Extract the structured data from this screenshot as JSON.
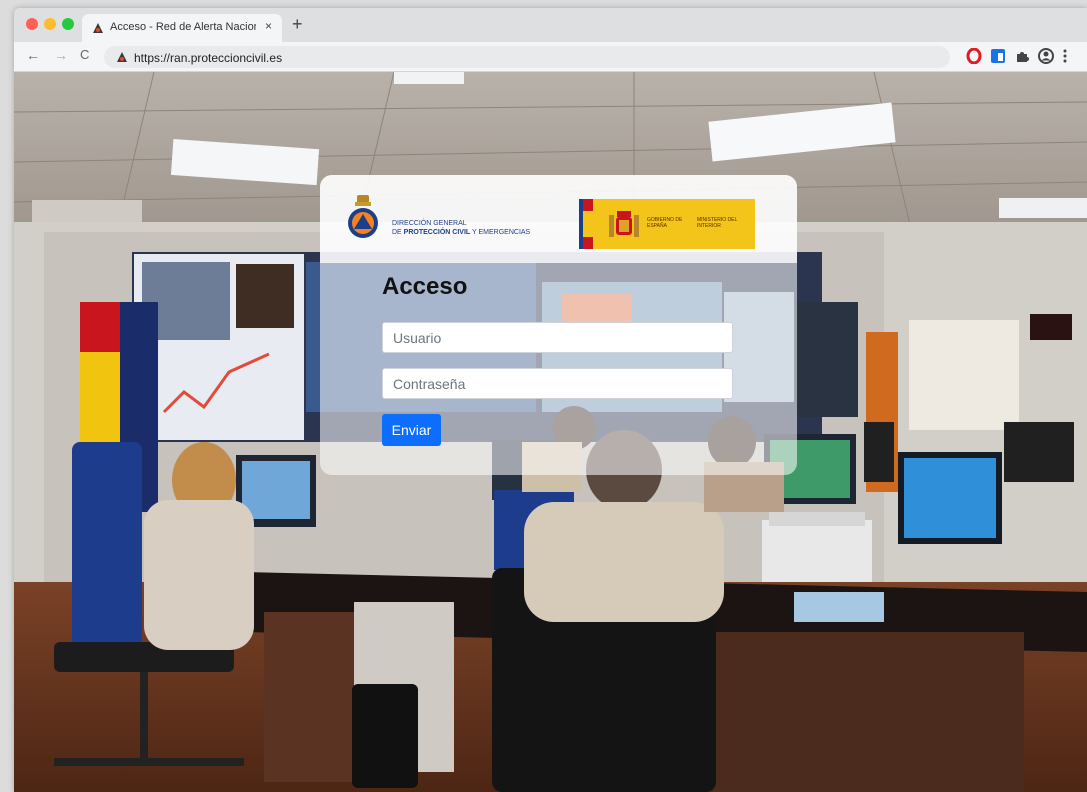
{
  "browser": {
    "tab_title": "Acceso - Red de Alerta Nacional",
    "tab_close": "×",
    "new_tab": "+",
    "url": "https://ran.proteccioncivil.es",
    "nav": {
      "back": "←",
      "forward": "→",
      "reload": "C"
    },
    "extensions": [
      "opera-icon",
      "translate-icon",
      "puzzle-icon",
      "profile-icon",
      "menu-icon"
    ]
  },
  "header": {
    "org_line1": "DIRECCIÓN GENERAL",
    "org_line2_prefix": "DE ",
    "org_line2_bold": "PROTECCIÓN CIVIL",
    "org_line2_suffix": " Y EMERGENCIAS",
    "gov_line1": "GOBIERNO DE ESPAÑA",
    "gov_line2": "MINISTERIO DEL INTERIOR"
  },
  "login": {
    "title": "Acceso",
    "user_placeholder": "Usuario",
    "password_placeholder": "Contraseña",
    "submit_label": "Enviar"
  },
  "colors": {
    "accent": "#0d6efd",
    "gov_yellow": "#f3c51a",
    "org_blue": "#1d3f8a"
  }
}
